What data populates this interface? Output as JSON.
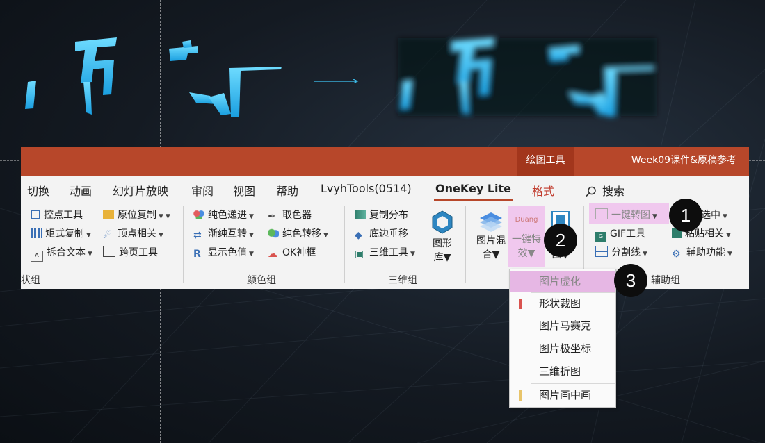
{
  "ribbon": {
    "context_tab": "绘图工具",
    "document_title": "Week09课件&原稿参考",
    "tabs": [
      "切换",
      "动画",
      "幻灯片放映",
      "审阅",
      "视图",
      "帮助",
      "LvyhTools(0514)",
      "OneKey Lite",
      "格式"
    ],
    "active_tab": "OneKey Lite",
    "search_label": "搜索",
    "groups": {
      "shape_group": {
        "label": "状组",
        "items": [
          "控点工具",
          "原位复制",
          "矩式复制",
          "顶点相关",
          "拆合文本",
          "跨页工具"
        ]
      },
      "color_group": {
        "label": "颜色组",
        "items": [
          "纯色递进",
          "取色器",
          "渐纯互转",
          "纯色转移",
          "显示色值",
          "OK神框"
        ]
      },
      "three_d_group": {
        "label": "三维组",
        "items": [
          "复制分布",
          "底边垂移",
          "三维工具"
        ],
        "gallery_button": [
          "图形",
          "库"
        ]
      },
      "image_group": {
        "blend_button": [
          "图片混",
          "合"
        ],
        "effect_button": [
          "一键特",
          "效"
        ],
        "effect_icon_text": "Duang",
        "image_button": "图"
      },
      "assist_group": {
        "label": "辅助组",
        "items": [
          "一键转图",
          "GIF工具",
          "分割线",
          "选中",
          "粘贴相关",
          "辅助功能"
        ]
      }
    }
  },
  "dropdown": {
    "items": [
      "图片虚化",
      "形状裁图",
      "图片马赛克",
      "图片极坐标",
      "三维折图",
      "图片画中画"
    ],
    "selected": "图片虚化",
    "mark_colors": [
      "#d9534f",
      "#e8c46a"
    ]
  },
  "badges": [
    "1",
    "2",
    "3"
  ],
  "colors": {
    "title_bar": "#b7472a",
    "highlight": "#f0c8ee",
    "logo_cyan": "#3ec5f5"
  }
}
